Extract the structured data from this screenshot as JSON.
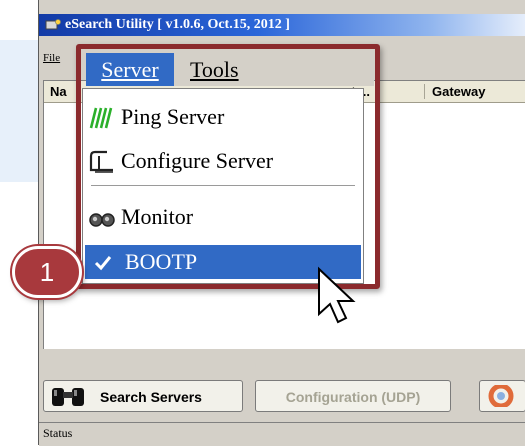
{
  "window": {
    "title": "eSearch Utility [ v1.0.6, Oct.15, 2012 ]",
    "menubar_file": "File"
  },
  "menu": {
    "server": "Server",
    "tools": "Tools",
    "server_items": [
      {
        "label": "Ping Server",
        "icon": "ping-icon"
      },
      {
        "label": "Configure Server",
        "icon": "configure-icon"
      },
      {
        "label": "Monitor",
        "icon": "monitor-icon"
      },
      {
        "label": "BOOTP",
        "icon": "check-icon",
        "checked": true,
        "highlighted": true
      }
    ]
  },
  "list": {
    "columns": [
      "Na",
      "et ...",
      "Gateway"
    ]
  },
  "toolbar": {
    "search_label": "Search Servers",
    "config_label": "Configuration (UDP)"
  },
  "statusbar": {
    "text": "Status"
  },
  "callout": {
    "step": "1"
  },
  "colors": {
    "highlight": "#316ac5",
    "callout": "#a8393d",
    "frame": "#8b2a2d"
  }
}
